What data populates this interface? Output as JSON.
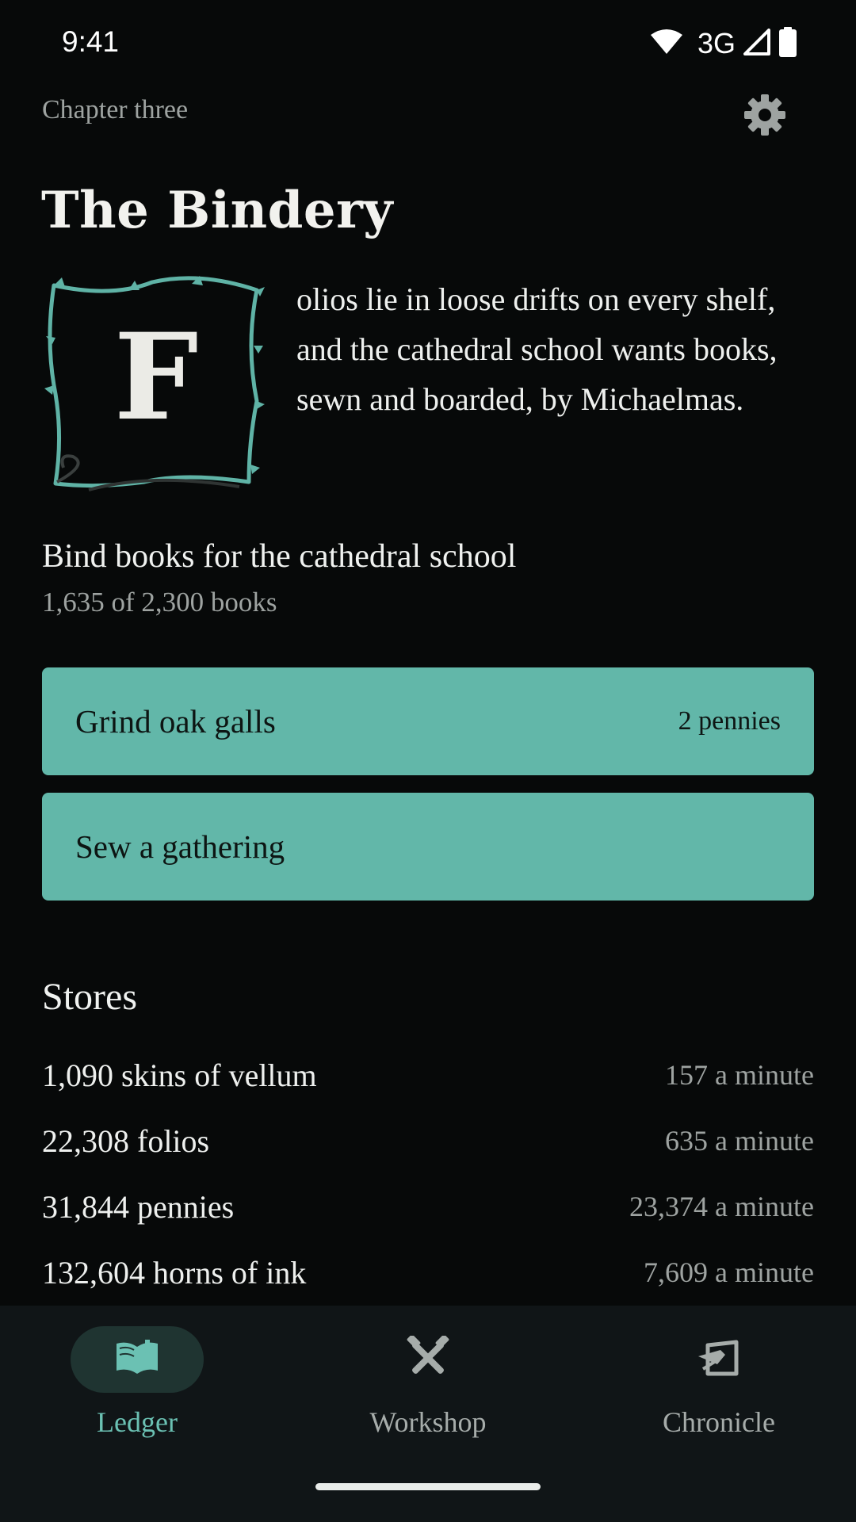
{
  "status_bar": {
    "time": "9:41",
    "network": "3G",
    "icons": [
      "wifi-icon",
      "cell-signal-icon",
      "battery-icon"
    ]
  },
  "header": {
    "chapter": "Chapter three",
    "settings_icon": "gear-icon",
    "title": "The Bindery"
  },
  "intro": {
    "drop_cap_letter": "F",
    "text": "olios lie in loose drifts on every shelf, and the cathedral school wants books, sewn and boarded, by Michaelmas."
  },
  "goal": {
    "title": "Bind books for the cathedral school",
    "progress_text": "1,635 of 2,300 books",
    "current": 1635,
    "target": 2300
  },
  "actions": [
    {
      "label": "Grind oak galls",
      "cost": "2 pennies"
    },
    {
      "label": "Sew a gathering",
      "cost": ""
    }
  ],
  "stores": {
    "heading": "Stores",
    "items": [
      {
        "name": "1,090 skins of vellum",
        "rate": "157 a minute"
      },
      {
        "name": "22,308 folios",
        "rate": "635 a minute"
      },
      {
        "name": "31,844 pennies",
        "rate": "23,374 a minute"
      },
      {
        "name": "132,604 horns of ink",
        "rate": "7,609 a minute"
      }
    ]
  },
  "nav": {
    "items": [
      {
        "label": "Ledger",
        "icon": "open-book-icon",
        "active": true
      },
      {
        "label": "Workshop",
        "icon": "hammer-wrench-icon",
        "active": false
      },
      {
        "label": "Chronicle",
        "icon": "quill-scroll-icon",
        "active": false
      }
    ]
  },
  "colors": {
    "background": "#070909",
    "accent": "#62b7a9",
    "nav_background": "#101517",
    "muted_text": "#9ea3a1"
  }
}
